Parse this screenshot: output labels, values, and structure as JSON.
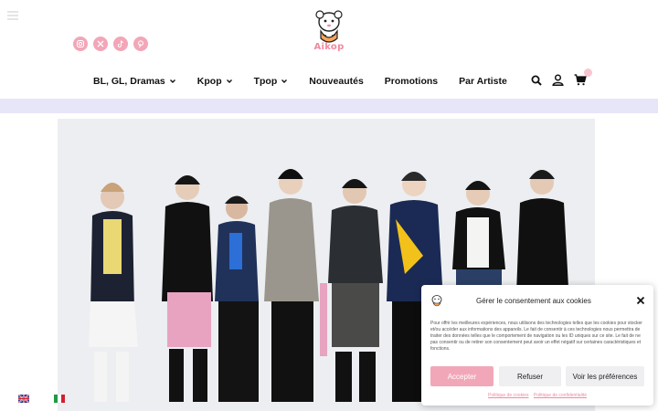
{
  "brand": {
    "logo_text": "Aikop",
    "accent_color": "#f08aa0"
  },
  "social": [
    {
      "icon": "instagram-icon"
    },
    {
      "icon": "x-icon"
    },
    {
      "icon": "tiktok-icon"
    },
    {
      "icon": "pinterest-icon"
    }
  ],
  "nav": {
    "items": [
      {
        "label": "BL, GL, Dramas",
        "has_dropdown": true
      },
      {
        "label": "Kpop",
        "has_dropdown": true
      },
      {
        "label": "Tpop",
        "has_dropdown": true
      },
      {
        "label": "Nouveautés",
        "has_dropdown": false
      },
      {
        "label": "Promotions",
        "has_dropdown": false
      },
      {
        "label": "Par Artiste",
        "has_dropdown": false
      }
    ]
  },
  "header_icons": [
    "search-icon",
    "user-icon",
    "cart-icon"
  ],
  "languages": [
    "en-flag-icon",
    "it-flag-icon"
  ],
  "cookie": {
    "title": "Gérer le consentement aux cookies",
    "text": "Pour offrir les meilleures expériences, nous utilisons des technologies telles que les cookies pour stocker et/ou accéder aux informations des appareils. Le fait de consentir à ces technologies nous permettra de traiter des données telles que le comportement de navigation ou les ID uniques sur ce site. Le fait de ne pas consentir ou de retirer son consentement peut avoir un effet négatif sur certaines caractéristiques et fonctions.",
    "accept_label": "Accepter",
    "refuse_label": "Refuser",
    "prefs_label": "Voir les préférences",
    "cookie_policy_label": "Politique de cookies",
    "privacy_policy_label": "Politique de confidentialité"
  }
}
